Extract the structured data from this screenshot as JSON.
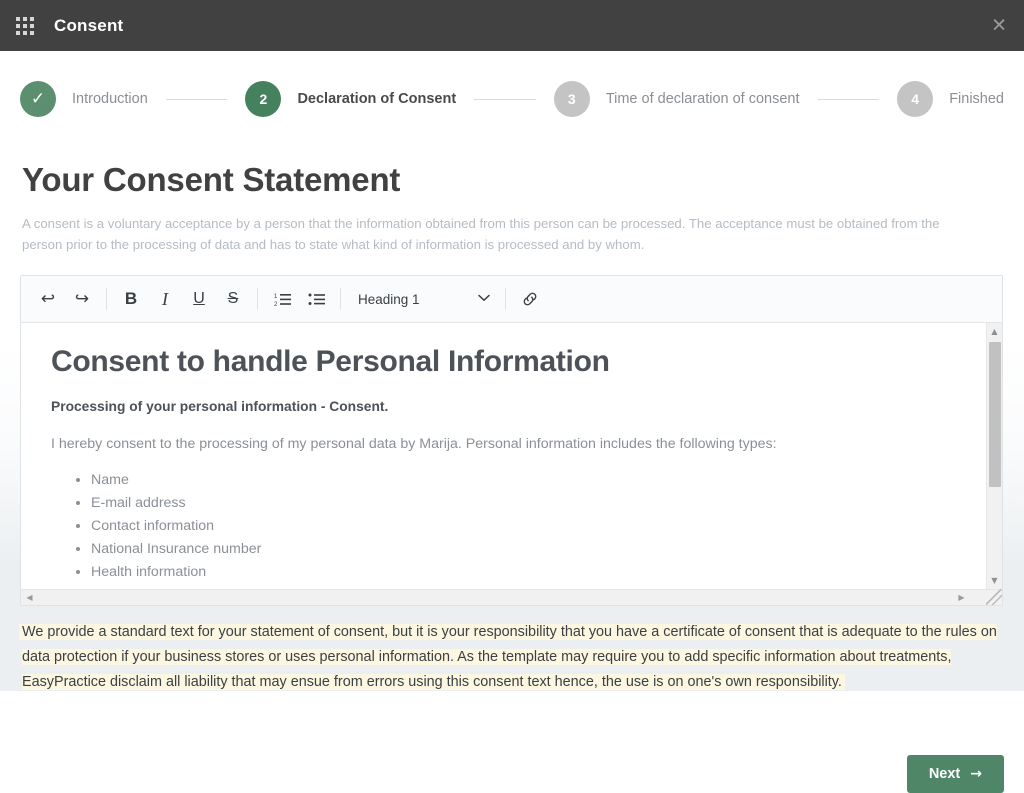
{
  "topbar": {
    "app_menu_icon": "grid-icon",
    "title": "Consent",
    "close_icon": "✕"
  },
  "stepper": {
    "steps": [
      {
        "marker": "✓",
        "label": "Introduction",
        "state": "done"
      },
      {
        "marker": "2",
        "label": "Declaration of Consent",
        "state": "active"
      },
      {
        "marker": "3",
        "label": "Time of declaration of consent",
        "state": "idle"
      },
      {
        "marker": "4",
        "label": "Finished",
        "state": "idle"
      }
    ]
  },
  "page": {
    "title": "Your Consent Statement",
    "description": "A consent is a voluntary acceptance by a person that the information obtained from this person can be processed. The acceptance must be obtained from the person prior to the processing of data and has to state what kind of information is processed and by whom."
  },
  "editor": {
    "toolbar": {
      "undo_icon": "↩",
      "redo_icon": "↪",
      "bold_label": "B",
      "italic_label": "I",
      "underline_label": "U",
      "strikethrough_label": "S",
      "ordered_list_icon": "ordered-list-icon",
      "bullet_list_icon": "bullet-list-icon",
      "block_format_value": "Heading 1",
      "chevron_icon": "⌄",
      "link_icon": "link-icon"
    },
    "document": {
      "heading": "Consent to handle Personal Information",
      "subheading": "Processing of your personal information - Consent.",
      "paragraph": "I hereby consent to the processing of my personal data by Marija. Personal information includes the following types:",
      "list": [
        "Name",
        "E-mail address",
        "Contact information",
        "National Insurance number",
        "Health information"
      ]
    },
    "scrollbar": {
      "up_arrow": "▲",
      "down_arrow": "▼",
      "left_arrow": "◀",
      "right_arrow": "▶"
    }
  },
  "note": {
    "text": "We provide a standard text for your statement of consent, but it is your responsibility that you have a certificate of consent that is adequate to the rules on data protection if your business stores or uses personal information. As the template may require you to add specific information about treatments, EasyPractice disclaim all liability that may ensue from errors using this consent text hence, the use is on one's own responsibility."
  },
  "footer": {
    "next_label": "Next",
    "next_arrow": "→"
  },
  "colors": {
    "topbar_bg": "#414141",
    "accent_green": "#4f8668",
    "step_done": "#5c8f70",
    "step_active": "#44815c",
    "step_idle": "#c4c4c4",
    "page_bg": "#eceff1",
    "note_highlight": "#fdf6e1"
  }
}
